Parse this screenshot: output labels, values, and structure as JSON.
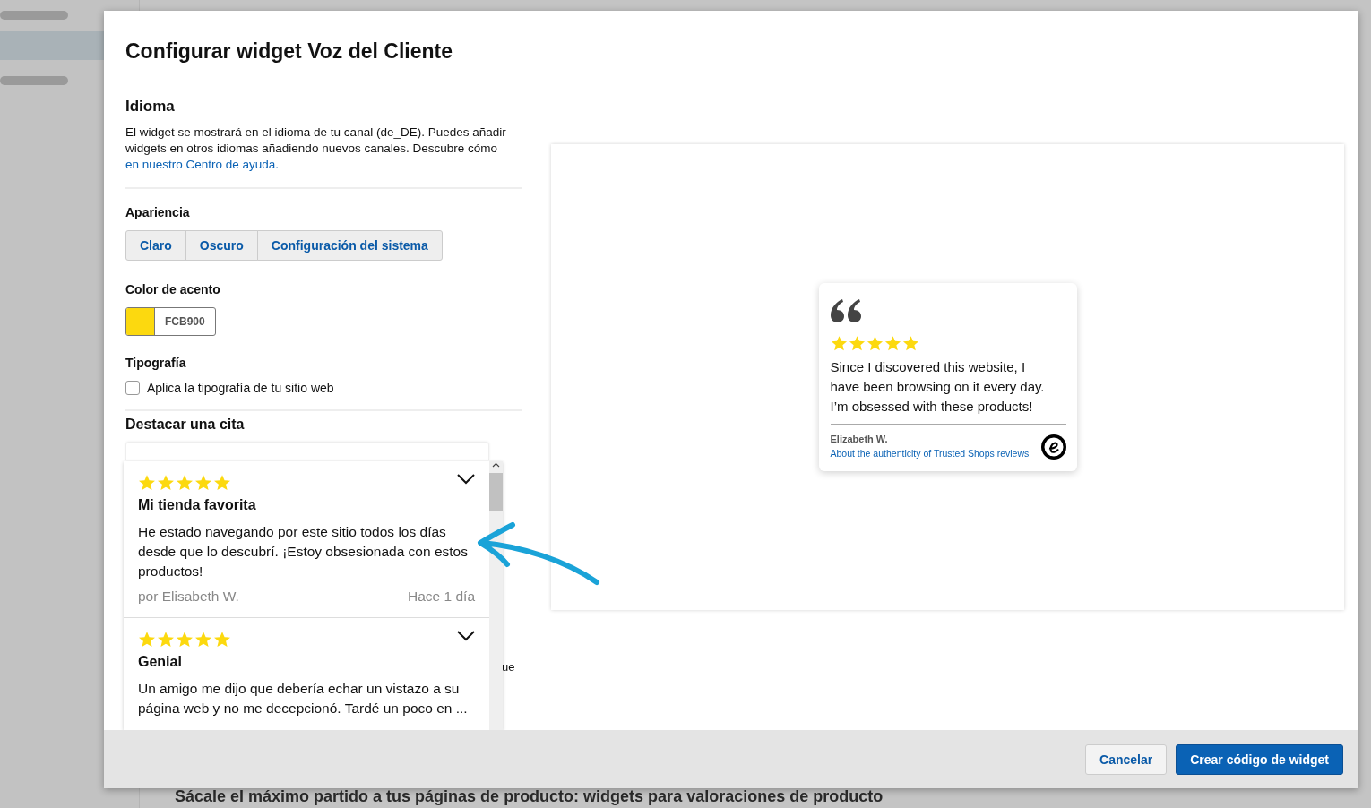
{
  "background": {
    "fragment": "ue",
    "heading": "Sácale el máximo partido a tus páginas de producto: widgets para valoraciones de producto"
  },
  "dialog": {
    "title": "Configurar widget Voz del Cliente"
  },
  "language": {
    "heading": "Idioma",
    "text": "El widget se mostrará en el idioma de tu canal (de_DE). Puedes añadir widgets en otros idiomas añadiendo nuevos canales. Descubre cómo",
    "link": "en nuestro Centro de ayuda."
  },
  "appearance": {
    "heading": "Apariencia",
    "options": [
      {
        "label": "Claro",
        "selected": false
      },
      {
        "label": "Oscuro",
        "selected": false
      },
      {
        "label": "Configuración del sistema",
        "selected": false
      }
    ]
  },
  "accent_color": {
    "heading": "Color de acento",
    "value": "FCB900",
    "color": "#fcd90f"
  },
  "typography": {
    "heading": "Tipografía",
    "checkbox": {
      "label": "Aplica la tipografía de tu sitio web",
      "checked": false
    }
  },
  "highlight_quote": {
    "heading": "Destacar una cita",
    "reviews": [
      {
        "stars": 5,
        "title": "Mi tienda favorita",
        "text": "He estado navegando por este sitio todos los días desde que lo descubrí. ¡Estoy obsesionada con estos productos!",
        "author": "por Elisabeth W.",
        "date": "Hace 1 día"
      },
      {
        "stars": 5,
        "title": "Genial",
        "text": "Un amigo me dijo que debería echar un vistazo a su página web y no me decepcionó. Tardé un poco en ..."
      }
    ]
  },
  "preview": {
    "stars": 5,
    "quote": "Since I discovered this website, I have been browsing on it every day. I’m obsessed with these products!",
    "author": "Elizabeth W.",
    "link": "About the authenticity of Trusted Shops reviews"
  },
  "footer": {
    "buttons": [
      {
        "label": "Cancelar",
        "kind": "secondary"
      },
      {
        "label": "Crear código de widget",
        "kind": "primary"
      }
    ]
  }
}
